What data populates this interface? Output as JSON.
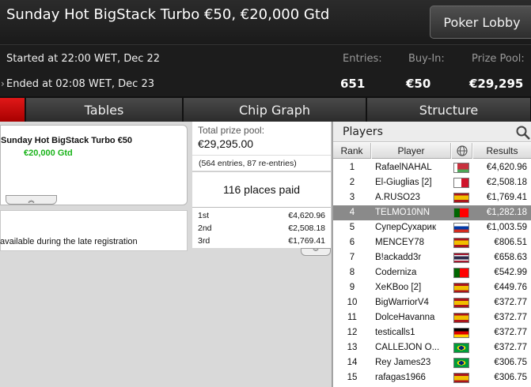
{
  "header": {
    "title": "Sunday Hot BigStack Turbo €50, €20,000 Gtd",
    "lobby_button": "Poker Lobby"
  },
  "info": {
    "started": "Started at 22:00 WET, Dec 22",
    "ended": "Ended at 02:08 WET, Dec 23",
    "entries_label": "Entries:",
    "entries_value": "651",
    "buyin_label": "Buy-In:",
    "buyin_value": "€50",
    "prizepool_label": "Prize Pool:",
    "prizepool_value": "€29,295"
  },
  "tabs": [
    "Tables",
    "Chip Graph",
    "Structure"
  ],
  "left": {
    "card_title": "Sunday Hot BigStack Turbo €50",
    "card_gtd": "€20,000 Gtd",
    "late_reg_text": "available during the late registration"
  },
  "middle": {
    "prize_label": "Total prize pool:",
    "prize_value": "€29,295.00",
    "entries_text": "(564 entries, 87 re-entries)",
    "places_text": "116 places paid",
    "payouts": [
      {
        "place": "1st",
        "amount": "€4,620.96"
      },
      {
        "place": "2nd",
        "amount": "€2,508.18"
      },
      {
        "place": "3rd",
        "amount": "€1,769.41"
      }
    ]
  },
  "players": {
    "title": "Players",
    "col_rank": "Rank",
    "col_player": "Player",
    "col_results": "Results",
    "rows": [
      {
        "rank": "1",
        "name": "RafaelNAHAL",
        "flag": "by",
        "result": "€4,620.96"
      },
      {
        "rank": "2",
        "name": "El-Giuglias [2]",
        "flag": "mt",
        "result": "€2,508.18"
      },
      {
        "rank": "3",
        "name": "A.RUSO23",
        "flag": "es",
        "result": "€1,769.41"
      },
      {
        "rank": "4",
        "name": "TELMO10NN",
        "flag": "pt",
        "result": "€1,282.18",
        "selected": true
      },
      {
        "rank": "5",
        "name": "СуперСухарик",
        "flag": "ru",
        "result": "€1,003.59"
      },
      {
        "rank": "6",
        "name": "MENCEY78",
        "flag": "es",
        "result": "€806.51"
      },
      {
        "rank": "7",
        "name": "B!ackadd3r",
        "flag": "th",
        "result": "€658.63"
      },
      {
        "rank": "8",
        "name": "Coderniza",
        "flag": "pt",
        "result": "€542.99"
      },
      {
        "rank": "9",
        "name": "XeKBoo [2]",
        "flag": "es",
        "result": "€449.76"
      },
      {
        "rank": "10",
        "name": "BigWarriorV4",
        "flag": "es",
        "result": "€372.77"
      },
      {
        "rank": "11",
        "name": "DolceHavanna",
        "flag": "es",
        "result": "€372.77"
      },
      {
        "rank": "12",
        "name": "testicalls1",
        "flag": "de",
        "result": "€372.77"
      },
      {
        "rank": "13",
        "name": "CALLEJÓN O...",
        "flag": "br",
        "result": "€372.77"
      },
      {
        "rank": "14",
        "name": "Rey James23",
        "flag": "br",
        "result": "€306.75"
      },
      {
        "rank": "15",
        "name": "rafagas1966",
        "flag": "es",
        "result": "€306.75"
      }
    ]
  },
  "colors": {
    "gtd_green": "#19b319",
    "selected_row": "#8a8a8a",
    "tab_red": "#c00000"
  }
}
